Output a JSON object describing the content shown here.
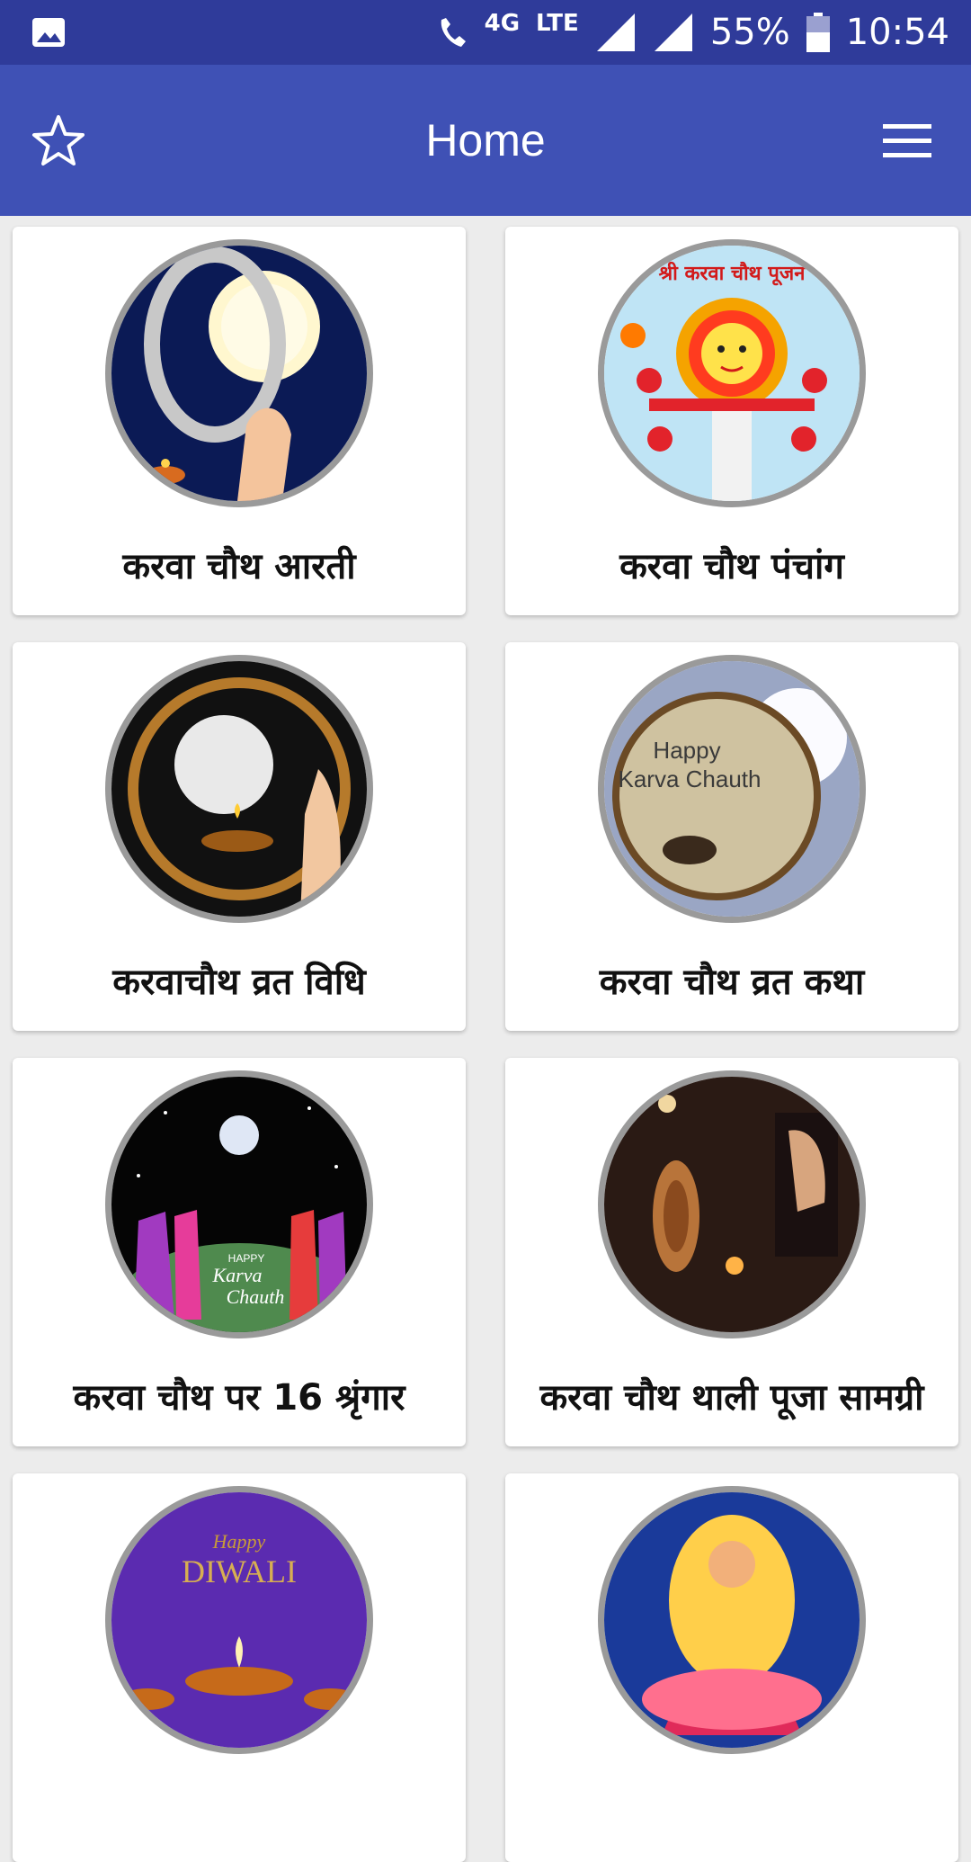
{
  "status_bar": {
    "network": "4G",
    "lte": "LTE",
    "battery": "55%",
    "time": "10:54"
  },
  "app_bar": {
    "title": "Home",
    "left_icon": "star-outline-icon",
    "right_icon": "hamburger-menu-icon"
  },
  "cards": [
    {
      "label": "करवा चौथ आरती"
    },
    {
      "label": "करवा चौथ पंचांग",
      "image_text": "श्री करवा चौथ पूजन"
    },
    {
      "label": "करवाचौथ व्रत विधि"
    },
    {
      "label": "करवा चौथ व्रत कथा",
      "image_text_1": "Happy",
      "image_text_2": "Karva Chauth"
    },
    {
      "label": "करवा चौथ पर 16 श्रृंगार",
      "image_text_1": "HAPPY",
      "image_text_2": "Karva",
      "image_text_3": "Chauth"
    },
    {
      "label": "करवा चौथ थाली पूजा सामग्री"
    },
    {
      "label": "",
      "image_text_1": "Happy",
      "image_text_2": "DIWALI"
    },
    {
      "label": ""
    }
  ],
  "colors": {
    "status_bar": "#2f3b9a",
    "app_bar": "#3f51b5",
    "background": "#ececec"
  }
}
